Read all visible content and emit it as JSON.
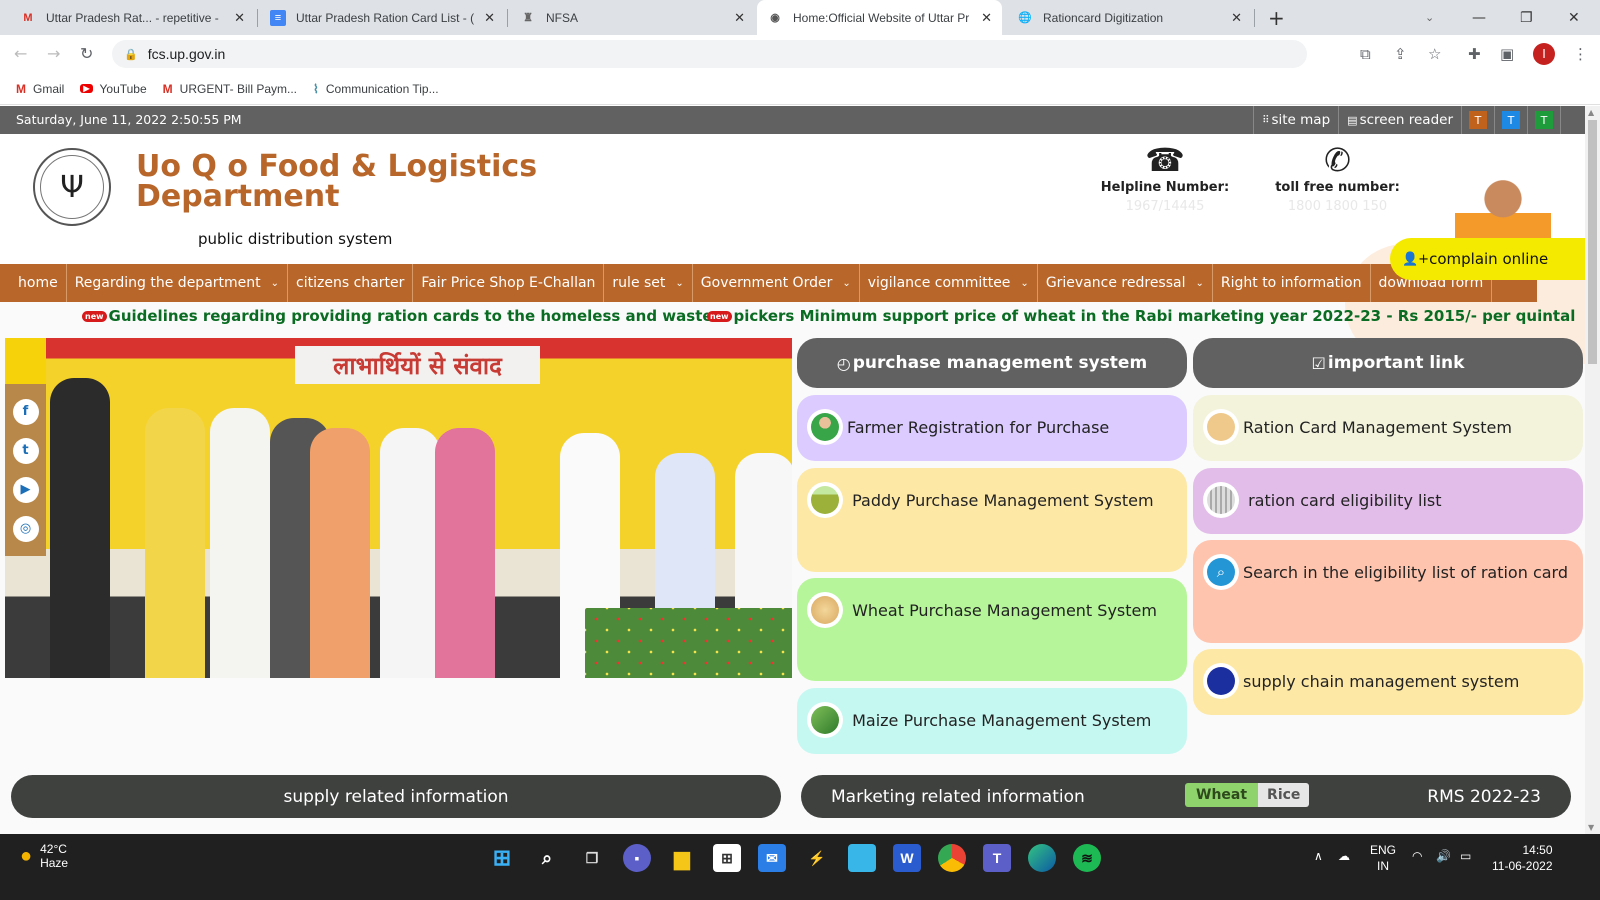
{
  "browser": {
    "tabs": [
      {
        "title": "Uttar Pradesh Rat... - repetitive -",
        "icon": "gmail-icon",
        "active": false
      },
      {
        "title": "Uttar Pradesh Ration Card List - (",
        "icon": "docs-icon",
        "active": false
      },
      {
        "title": "NFSA",
        "icon": "emblem-icon",
        "active": false
      },
      {
        "title": "Home:Official Website of Uttar Pr",
        "icon": "up-emblem-icon",
        "active": true
      },
      {
        "title": "Rationcard Digitization",
        "icon": "globe-icon",
        "active": false
      }
    ],
    "new_tab": "+",
    "url": "fcs.up.gov.in",
    "profile_initial": "I",
    "bookmarks": [
      {
        "label": "Gmail",
        "icon": "gmail-icon"
      },
      {
        "label": "YouTube",
        "icon": "youtube-icon"
      },
      {
        "label": "URGENT- Bill Paym...",
        "icon": "gmail-icon"
      },
      {
        "label": "Communication Tip...",
        "icon": "chart-icon"
      }
    ]
  },
  "topstrip": {
    "datetime": "Saturday, June 11, 2022 2:50:55 PM",
    "site_map": "site map",
    "screen_reader": "screen reader",
    "themes": [
      {
        "label": "T",
        "color": "#c0621c"
      },
      {
        "label": "T",
        "color": "#1e88e5"
      },
      {
        "label": "T",
        "color": "#1e9b3b"
      }
    ]
  },
  "header": {
    "title_line1": "Uo Q o Food & Logistics",
    "title_line2": "Department",
    "subtitle": "public distribution system",
    "helpline_label": "Helpline Number:",
    "helpline_value": "1967/14445",
    "tollfree_label": "toll free number:",
    "tollfree_value": "1800 1800 150",
    "complain": "complain online"
  },
  "menu": [
    {
      "label": "home",
      "dropdown": false
    },
    {
      "label": "Regarding the department",
      "dropdown": true
    },
    {
      "label": "citizens charter",
      "dropdown": false
    },
    {
      "label": "Fair Price Shop E-Challan",
      "dropdown": false
    },
    {
      "label": "rule set",
      "dropdown": true
    },
    {
      "label": "Government Order",
      "dropdown": true
    },
    {
      "label": "vigilance committee",
      "dropdown": true
    },
    {
      "label": "Grievance redressal",
      "dropdown": true
    },
    {
      "label": "Right to information",
      "dropdown": false
    },
    {
      "label": "download form",
      "dropdown": false
    }
  ],
  "ticker": {
    "badge": "new",
    "items": [
      "Guidelines regarding providing ration cards to the homeless and waste",
      "pickers Minimum support price of wheat in the Rabi marketing year 2022-23 - Rs 2015/- per quintal"
    ]
  },
  "slider": {
    "banner_text": "लाभार्थियों से संवाद"
  },
  "social": [
    "f",
    "t",
    "▶",
    "◎"
  ],
  "purchase": {
    "heading": "purchase management system",
    "items": [
      {
        "label": "Farmer Registration for Purchase",
        "color": "#dccbff"
      },
      {
        "label": "Paddy Purchase Management System",
        "color": "#fde8a6"
      },
      {
        "label": "Wheat Purchase Management System",
        "color": "#b6f59a"
      },
      {
        "label": "Maize Purchase Management System",
        "color": "#c6f8f2"
      }
    ]
  },
  "important": {
    "heading": "important link",
    "items": [
      {
        "label": "Ration Card Management System",
        "color": "#f3f3dc"
      },
      {
        "label": "ration card eligibility list",
        "color": "#e3bdea"
      },
      {
        "label": "Search in the eligibility list of ration card",
        "color": "#fec4ae"
      },
      {
        "label": "supply chain management system",
        "color": "#fde8a6"
      }
    ]
  },
  "bottom": {
    "supply": "supply related information",
    "marketing": "Marketing related information",
    "seg_wheat": "Wheat",
    "seg_rice": "Rice",
    "rms": "RMS 2022-23"
  },
  "taskbar": {
    "temp": "42°C",
    "weather": "Haze",
    "lang1": "ENG",
    "lang2": "IN",
    "time": "14:50",
    "date": "11-06-2022"
  }
}
